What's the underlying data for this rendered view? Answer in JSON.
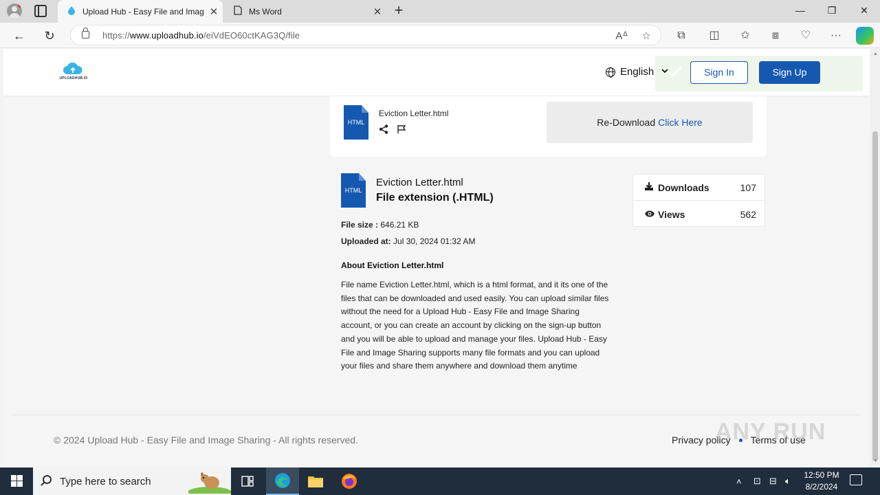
{
  "browser": {
    "tabs": [
      {
        "title": "Upload Hub - Easy File and Imag",
        "active": true
      },
      {
        "title": "Ms Word",
        "active": false
      }
    ],
    "url_prefix": "https://",
    "url_domain": "www.uploadhub.io",
    "url_path": "/eiVdEO60ctKAG3Q/file"
  },
  "header": {
    "logo_text": "UPLOADHUB.IO",
    "language": "English",
    "signin_label": "Sign In",
    "signup_label": "Sign Up"
  },
  "file_card": {
    "icon_text": "HTML",
    "name": "Eviction Letter.html",
    "redownload_text": "Re-Download",
    "redownload_link": "Click Here"
  },
  "details": {
    "icon_text": "HTML",
    "title": "Eviction Letter.html",
    "extension": "File extension (.HTML)",
    "size_label": "File size :",
    "size_value": "646.21 KB",
    "uploaded_label": "Uploaded at:",
    "uploaded_value": "Jul 30, 2024 01:32 AM",
    "about_title": "About Eviction Letter.html",
    "about_text": "File name Eviction Letter.html, which is a html format, and it its one of the files that can be downloaded and used easily. You can upload similar files without the need for a Upload Hub - Easy File and Image Sharing account, or you can create an account by clicking on the sign-up button and you will be able to upload and manage your files. Upload Hub - Easy File and Image Sharing supports many file formats and you can upload your files and share them anywhere and download them anytime"
  },
  "stats": {
    "downloads_label": "Downloads",
    "downloads_value": "107",
    "views_label": "Views",
    "views_value": "562"
  },
  "footer": {
    "copyright": "© 2024 Upload Hub - Easy File and Image Sharing - All rights reserved.",
    "privacy": "Privacy policy",
    "terms": "Terms of use",
    "watermark": "ANY RUN"
  },
  "taskbar": {
    "search_placeholder": "Type here to search",
    "time": "12:50 PM",
    "date": "8/2/2024"
  },
  "colors": {
    "brand_blue": "#1558b0",
    "taskbar": "#1f2d3d"
  }
}
